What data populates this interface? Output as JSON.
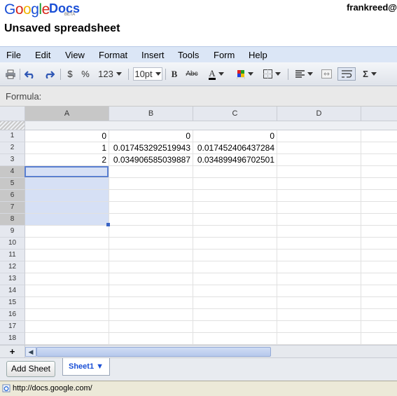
{
  "brand": {
    "google": "Google",
    "docs": "Docs",
    "beta": "BETA"
  },
  "user": "frankreed@",
  "document": {
    "title": "Unsaved spreadsheet"
  },
  "menu": [
    "File",
    "Edit",
    "View",
    "Format",
    "Insert",
    "Tools",
    "Form",
    "Help"
  ],
  "toolbar": {
    "print_icon": "print-icon",
    "undo_icon": "undo-icon",
    "redo_icon": "redo-icon",
    "currency": "$",
    "percent": "%",
    "number_format": "123",
    "font_size": "10pt",
    "bold": "B",
    "strikethrough": "Abc",
    "text_color": "A",
    "sum": "Σ"
  },
  "formula": {
    "label": "Formula:"
  },
  "grid": {
    "columns": [
      "A",
      "B",
      "C",
      "D"
    ],
    "row_numbers": [
      "1",
      "2",
      "3",
      "4",
      "5",
      "6",
      "7",
      "8",
      "9",
      "10",
      "11",
      "12",
      "13",
      "14",
      "15",
      "16",
      "17",
      "18"
    ],
    "rows": [
      [
        "0",
        "0",
        "0"
      ],
      [
        "1",
        "0.017453292519943",
        "0.017452406437284"
      ],
      [
        "2",
        "0.034906585039887",
        "0.034899496702501"
      ]
    ],
    "selected_range": "A4:A8"
  },
  "sheets": {
    "add_label": "Add Sheet",
    "active": "Sheet1 ▼"
  },
  "status": {
    "url": "http://docs.google.com/"
  },
  "colors": {
    "menu_bg": "#dbe6f6",
    "selection": "#d6e0f5",
    "accent": "#1a4fd6"
  }
}
